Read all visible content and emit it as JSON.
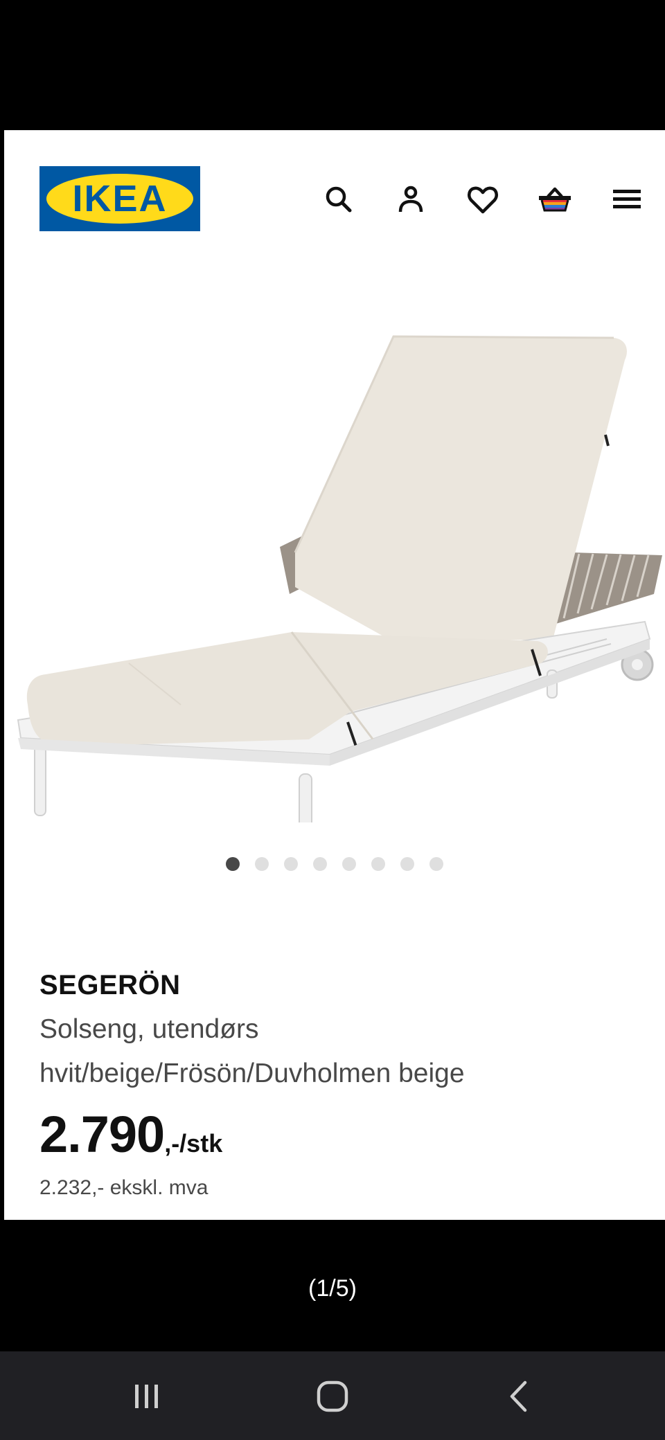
{
  "header": {
    "logo_text": "IKEA",
    "icons": [
      "search-icon",
      "account-icon",
      "heart-icon",
      "basket-icon",
      "menu-icon"
    ]
  },
  "gallery": {
    "dots_total": 8,
    "active_index": 0
  },
  "product": {
    "name": "SEGERÖN",
    "type": "Solseng, utendørs",
    "variant": "hvit/beige/Frösön/Duvholmen beige",
    "price_main": "2.790",
    "price_suffix": ",-/stk",
    "price_ex_vat": "2.232,- ekskl. mva"
  },
  "viewer": {
    "counter": "(1/5)"
  },
  "colors": {
    "brand_blue": "#0058A3",
    "brand_yellow": "#FFDA1A"
  }
}
